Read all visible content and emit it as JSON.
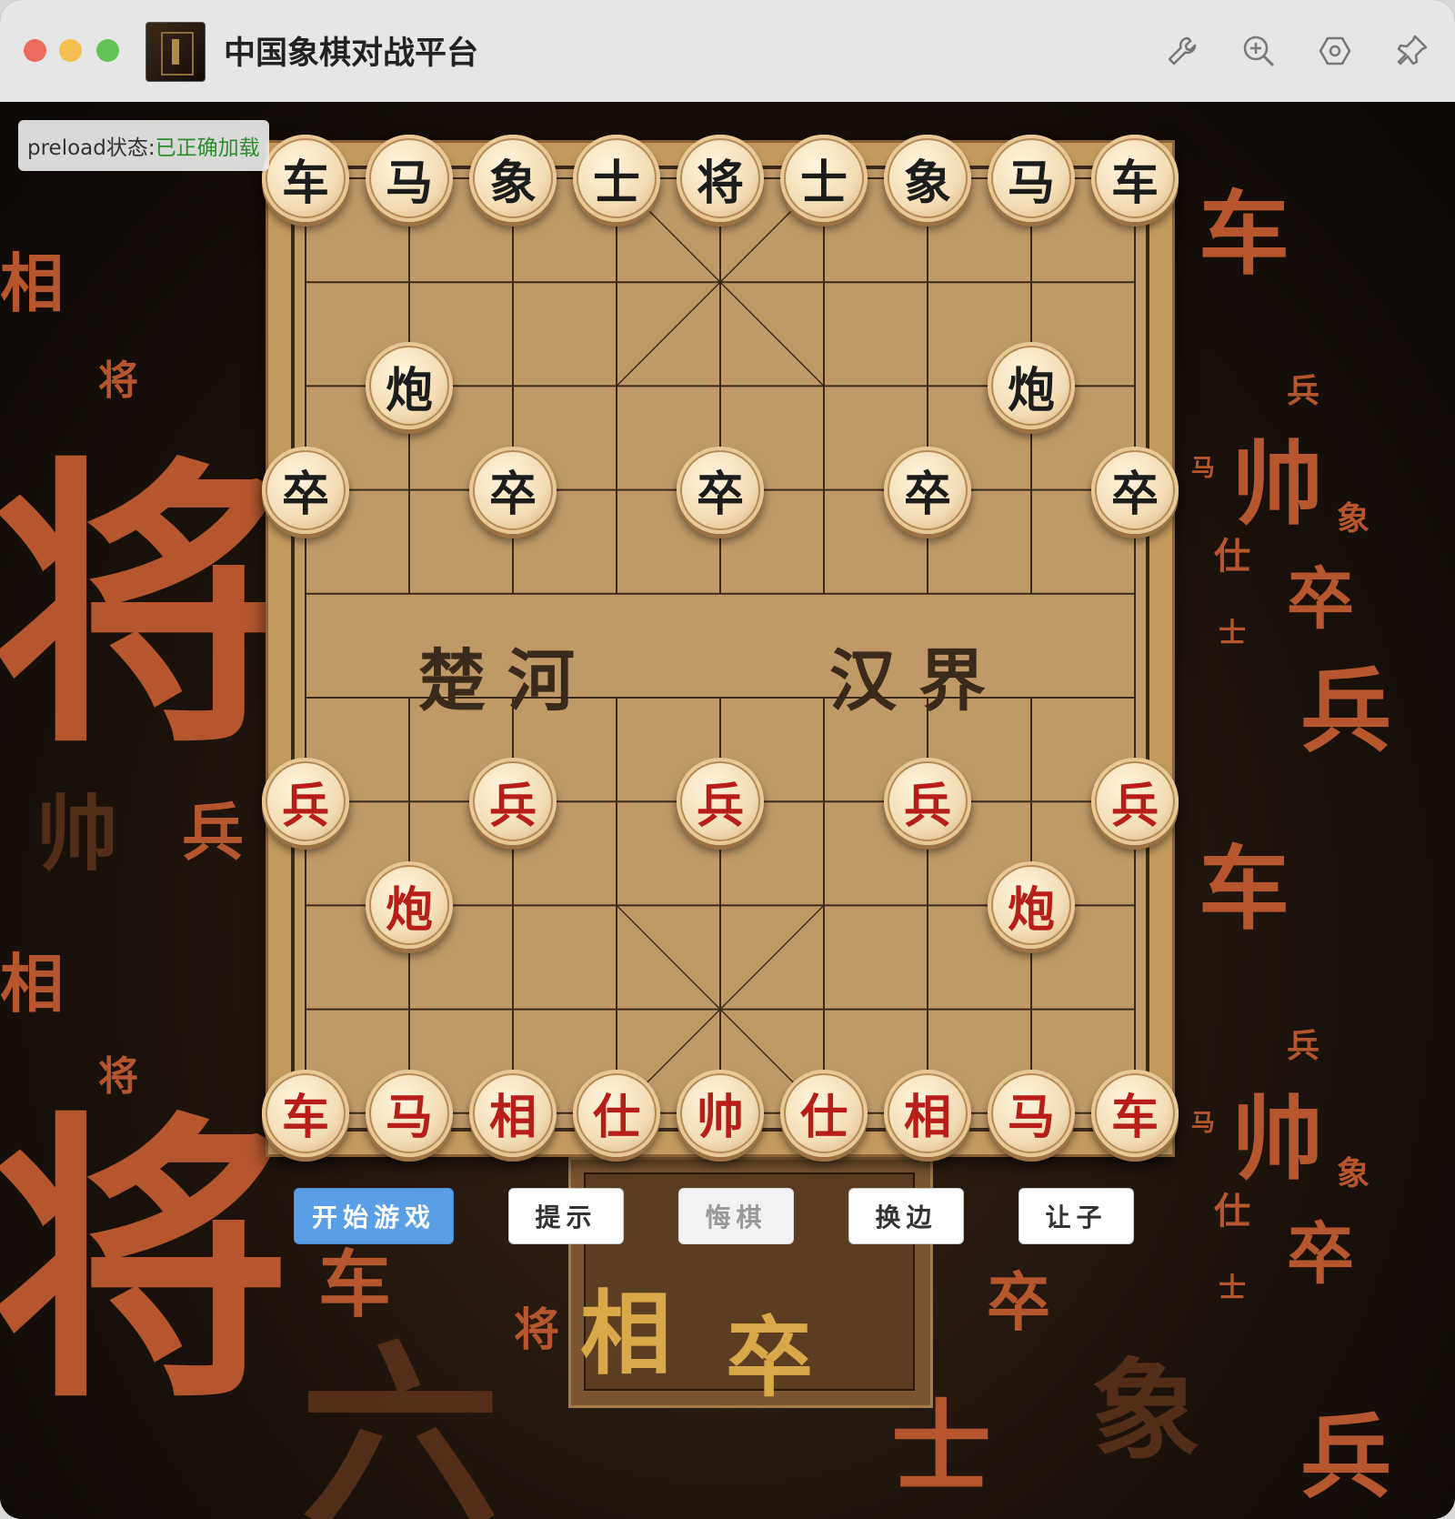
{
  "window": {
    "title": "中国象棋对战平台"
  },
  "toolbar": {
    "icons": [
      "wrench-icon",
      "zoom-in-icon",
      "settings-hexagon-icon",
      "pin-icon"
    ]
  },
  "preload": {
    "label": "preload状态: ",
    "status": "已正确加载"
  },
  "board": {
    "river_left": "楚河",
    "river_right": "汉界",
    "black_pieces": [
      {
        "char": "车",
        "col": 0,
        "row": 0
      },
      {
        "char": "马",
        "col": 1,
        "row": 0
      },
      {
        "char": "象",
        "col": 2,
        "row": 0
      },
      {
        "char": "士",
        "col": 3,
        "row": 0
      },
      {
        "char": "将",
        "col": 4,
        "row": 0
      },
      {
        "char": "士",
        "col": 5,
        "row": 0
      },
      {
        "char": "象",
        "col": 6,
        "row": 0
      },
      {
        "char": "马",
        "col": 7,
        "row": 0
      },
      {
        "char": "车",
        "col": 8,
        "row": 0
      },
      {
        "char": "炮",
        "col": 1,
        "row": 2
      },
      {
        "char": "炮",
        "col": 7,
        "row": 2
      },
      {
        "char": "卒",
        "col": 0,
        "row": 3
      },
      {
        "char": "卒",
        "col": 2,
        "row": 3
      },
      {
        "char": "卒",
        "col": 4,
        "row": 3
      },
      {
        "char": "卒",
        "col": 6,
        "row": 3
      },
      {
        "char": "卒",
        "col": 8,
        "row": 3
      }
    ],
    "red_pieces": [
      {
        "char": "兵",
        "col": 0,
        "row": 6
      },
      {
        "char": "兵",
        "col": 2,
        "row": 6
      },
      {
        "char": "兵",
        "col": 4,
        "row": 6
      },
      {
        "char": "兵",
        "col": 6,
        "row": 6
      },
      {
        "char": "兵",
        "col": 8,
        "row": 6
      },
      {
        "char": "炮",
        "col": 1,
        "row": 7
      },
      {
        "char": "炮",
        "col": 7,
        "row": 7
      },
      {
        "char": "车",
        "col": 0,
        "row": 9
      },
      {
        "char": "马",
        "col": 1,
        "row": 9
      },
      {
        "char": "相",
        "col": 2,
        "row": 9
      },
      {
        "char": "仕",
        "col": 3,
        "row": 9
      },
      {
        "char": "帅",
        "col": 4,
        "row": 9
      },
      {
        "char": "仕",
        "col": 5,
        "row": 9
      },
      {
        "char": "相",
        "col": 6,
        "row": 9
      },
      {
        "char": "马",
        "col": 7,
        "row": 9
      },
      {
        "char": "车",
        "col": 8,
        "row": 9
      }
    ]
  },
  "buttons": {
    "start": "开始游戏",
    "hint": "提示",
    "undo": "悔棋",
    "swap": "换边",
    "handicap": "让子"
  },
  "colors": {
    "accent": "#5a9ee6",
    "red_piece": "#b81e18",
    "bg_char": "#b5562e"
  }
}
